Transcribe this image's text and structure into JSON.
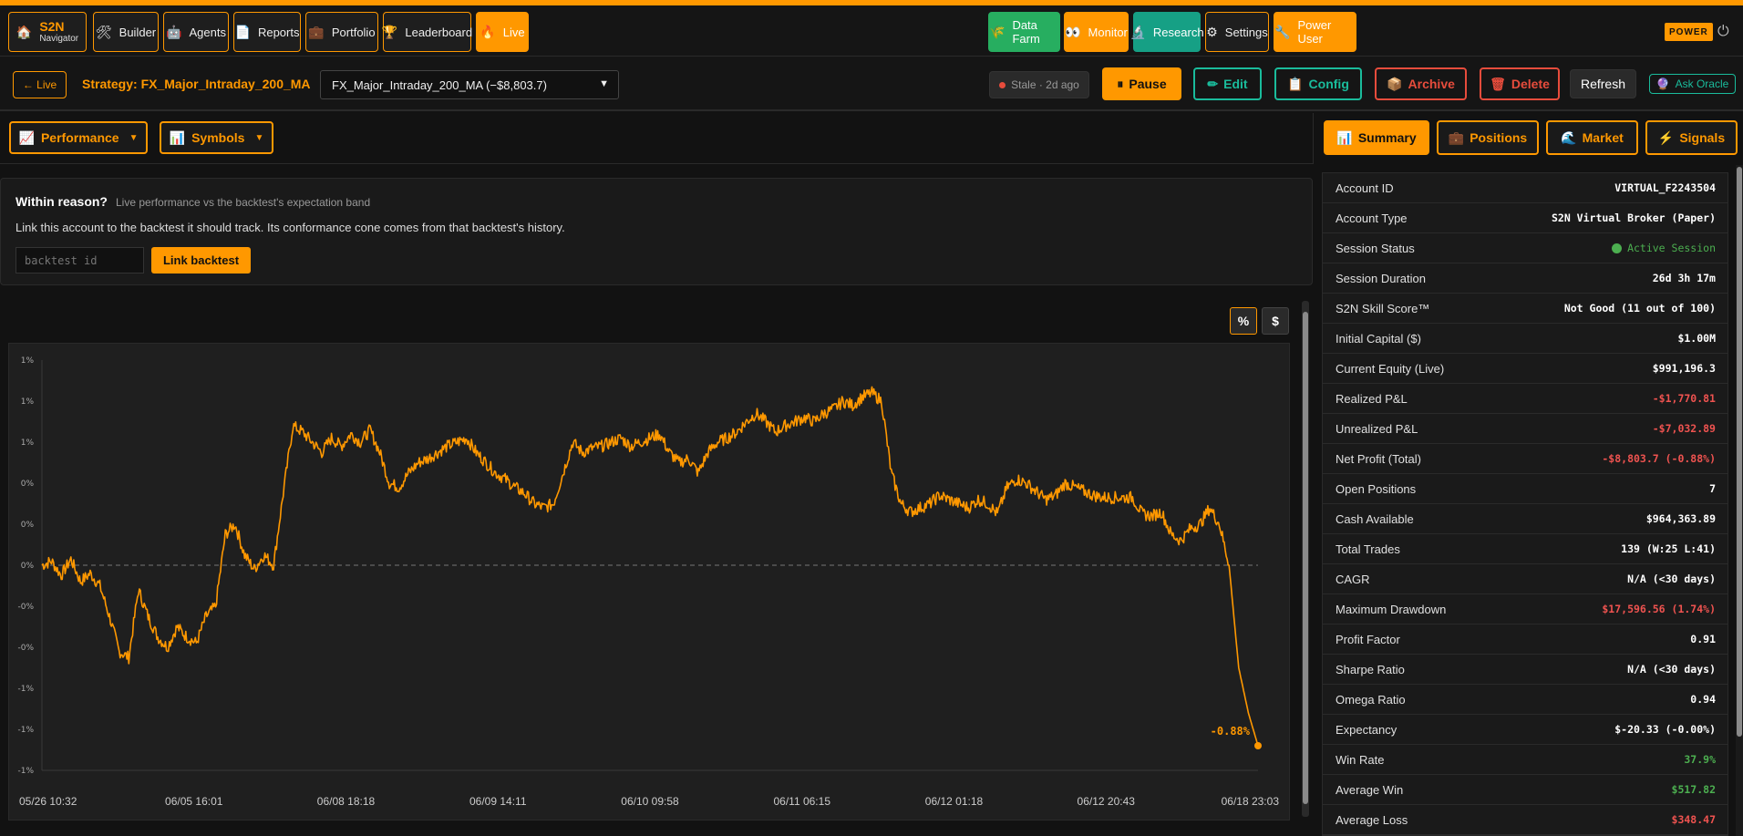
{
  "nav": {
    "brand_title": "S2N",
    "brand_sub": "Navigator",
    "items": [
      {
        "label": "Builder",
        "icon": "🛠"
      },
      {
        "label": "Agents",
        "icon": "🤖"
      },
      {
        "label": "Reports",
        "icon": "📄"
      },
      {
        "label": "Portfolio",
        "icon": "💼"
      },
      {
        "label": "Leaderboard",
        "icon": "🏆"
      },
      {
        "label": "Live",
        "icon": "🔥"
      }
    ],
    "right": [
      {
        "label": "Data Farm",
        "icon": "🌾"
      },
      {
        "label": "Monitor",
        "icon": "👀"
      },
      {
        "label": "Research",
        "icon": "🔬"
      },
      {
        "label": "Settings",
        "icon": "⚙"
      },
      {
        "label": "Power User",
        "icon": "🔧"
      }
    ],
    "badge": "POWER",
    "power_icon": "⏻"
  },
  "strategy": {
    "back_label": "← Live",
    "title": "Strategy: FX_Major_Intraday_200_MA",
    "select_value": "FX_Major_Intraday_200_MA (−$8,803.7)",
    "stale": "Stale · 2d ago",
    "pause": "Pause",
    "pause_icon": "⏸",
    "edit": "Edit",
    "edit_icon": "✏",
    "config": "Config",
    "config_icon": "📋",
    "archive": "Archive",
    "archive_icon": "📦",
    "delete": "Delete",
    "delete_icon": "🗑",
    "refresh": "Refresh",
    "oracle": "Ask Oracle",
    "oracle_icon": "🔮"
  },
  "subtabs": [
    {
      "label": "Performance",
      "icon": "📈"
    },
    {
      "label": "Symbols",
      "icon": "📊"
    }
  ],
  "reason": {
    "title": "Within reason?",
    "subtitle": "Live performance vs the backtest's expectation band",
    "desc": "Link this account to the backtest it should track. Its conformance cone comes from that backtest's history.",
    "placeholder": "backtest id",
    "button": "Link backtest"
  },
  "units": {
    "percent": "%",
    "dollar": "$"
  },
  "right_tabs": [
    {
      "label": "Summary",
      "icon": "📊"
    },
    {
      "label": "Positions",
      "icon": "💼"
    },
    {
      "label": "Market",
      "icon": "🌊"
    },
    {
      "label": "Signals",
      "icon": "⚡"
    }
  ],
  "summary": [
    {
      "k": "Account ID",
      "v": "VIRTUAL_F2243504",
      "t": ""
    },
    {
      "k": "Account Type",
      "v": "S2N Virtual Broker (Paper)",
      "t": ""
    },
    {
      "k": "Session Status",
      "v": "Active Session",
      "t": "act"
    },
    {
      "k": "Session Duration",
      "v": "26d 3h 17m",
      "t": ""
    },
    {
      "k": "S2N Skill Score™",
      "v": "Not Good (11 out of 100)",
      "t": ""
    },
    {
      "k": "Initial Capital ($)",
      "v": "$1.00M",
      "t": ""
    },
    {
      "k": "Current Equity (Live)",
      "v": "$991,196.3",
      "t": ""
    },
    {
      "k": "Realized P&L",
      "v": "-$1,770.81",
      "t": "neg"
    },
    {
      "k": "Unrealized P&L",
      "v": "-$7,032.89",
      "t": "neg"
    },
    {
      "k": "Net Profit (Total)",
      "v": "-$8,803.7 (-0.88%)",
      "t": "neg"
    },
    {
      "k": "Open Positions",
      "v": "7",
      "t": ""
    },
    {
      "k": "Cash Available",
      "v": "$964,363.89",
      "t": ""
    },
    {
      "k": "Total Trades",
      "v": "139 (W:25 L:41)",
      "t": ""
    },
    {
      "k": "CAGR",
      "v": "N/A (<30 days)",
      "t": ""
    },
    {
      "k": "Maximum Drawdown",
      "v": "$17,596.56 (1.74%)",
      "t": "neg"
    },
    {
      "k": "Profit Factor",
      "v": "0.91",
      "t": ""
    },
    {
      "k": "Sharpe Ratio",
      "v": "N/A (<30 days)",
      "t": ""
    },
    {
      "k": "Omega Ratio",
      "v": "0.94",
      "t": ""
    },
    {
      "k": "Expectancy",
      "v": "$-20.33 (-0.00%)",
      "t": ""
    },
    {
      "k": "Win Rate",
      "v": "37.9%",
      "t": "pos"
    },
    {
      "k": "Average Win",
      "v": "$517.82",
      "t": "pos"
    },
    {
      "k": "Average Loss",
      "v": "$348.47",
      "t": "neg"
    }
  ],
  "chart_data": {
    "type": "line",
    "y_tick_labels": [
      "1%",
      "1%",
      "1%",
      "0%",
      "0%",
      "0%",
      "-0%",
      "-0%",
      "-1%",
      "-1%",
      "-1%"
    ],
    "y_tick_values": [
      1.0,
      0.8,
      0.6,
      0.4,
      0.2,
      0.0,
      -0.2,
      -0.4,
      -0.6,
      -0.8,
      -1.0
    ],
    "ylim": [
      -1.0,
      1.0
    ],
    "x_tick_labels": [
      "05/26 10:32",
      "06/05 16:01",
      "06/08 18:18",
      "06/09 14:11",
      "06/10 09:58",
      "06/11 06:15",
      "06/12 01:18",
      "06/12 20:43",
      "06/18 23:03"
    ],
    "baseline": 0.0,
    "last_label": "-0.88%",
    "line_color": "#ff9800",
    "series": [
      {
        "values": [
          0.0,
          0.02,
          -0.05,
          0.03,
          -0.08,
          -0.04,
          -0.1,
          -0.25,
          -0.42,
          -0.45,
          -0.12,
          -0.25,
          -0.35,
          -0.4,
          -0.3,
          -0.35,
          -0.38,
          -0.25,
          -0.2,
          0.15,
          0.2,
          0.05,
          -0.02,
          0.05,
          0.0,
          0.35,
          0.68,
          0.65,
          0.6,
          0.55,
          0.62,
          0.58,
          0.64,
          0.6,
          0.66,
          0.55,
          0.4,
          0.38,
          0.45,
          0.5,
          0.52,
          0.55,
          0.58,
          0.6,
          0.62,
          0.55,
          0.5,
          0.45,
          0.42,
          0.38,
          0.35,
          0.3,
          0.28,
          0.3,
          0.45,
          0.6,
          0.55,
          0.57,
          0.58,
          0.6,
          0.62,
          0.58,
          0.6,
          0.62,
          0.64,
          0.55,
          0.5,
          0.52,
          0.45,
          0.55,
          0.6,
          0.62,
          0.65,
          0.7,
          0.74,
          0.7,
          0.65,
          0.68,
          0.7,
          0.72,
          0.7,
          0.74,
          0.76,
          0.8,
          0.78,
          0.82,
          0.84,
          0.8,
          0.45,
          0.3,
          0.26,
          0.28,
          0.3,
          0.34,
          0.32,
          0.3,
          0.28,
          0.32,
          0.3,
          0.25,
          0.38,
          0.42,
          0.4,
          0.36,
          0.32,
          0.34,
          0.4,
          0.38,
          0.36,
          0.34,
          0.33,
          0.33,
          0.33,
          0.33,
          0.25,
          0.24,
          0.26,
          0.15,
          0.12,
          0.18,
          0.2,
          0.28,
          0.2,
          0.0,
          -0.5,
          -0.72,
          -0.88
        ]
      }
    ]
  }
}
